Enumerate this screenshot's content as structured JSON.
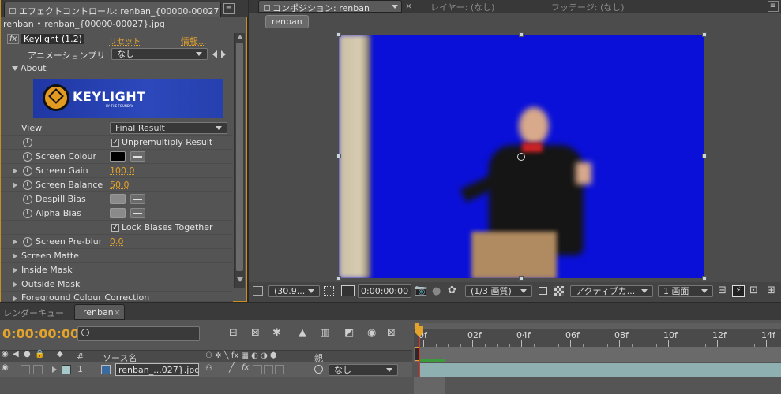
{
  "effects_panel": {
    "tab_title": "エフェクトコントロール: renban_{00000-00027",
    "breadcrumb": "renban • renban_{00000-00027}.jpg",
    "effect_name": "Keylight (1.2)",
    "fx_label": "fx",
    "reset_label": "リセット",
    "info_label": "情報...",
    "animation_preset_label": "アニメーションプリ",
    "animation_preset_value": "なし",
    "about_label": "About",
    "logo_text": "KEYLIGHT",
    "logo_sub": "BY THE FOUNDRY",
    "logo_color": "#2a44b8",
    "view_label": "View",
    "view_value": "Final Result",
    "unpremultiply_label": "Unpremultiply Result",
    "screen_colour_label": "Screen Colour",
    "screen_gain_label": "Screen Gain",
    "screen_gain_value": "100.0",
    "screen_balance_label": "Screen Balance",
    "screen_balance_value": "50.0",
    "despill_bias_label": "Despill Bias",
    "alpha_bias_label": "Alpha Bias",
    "lock_biases_label": "Lock Biases Together",
    "screen_preblur_label": "Screen Pre-blur",
    "screen_preblur_value": "0.0",
    "screen_matte_label": "Screen Matte",
    "inside_mask_label": "Inside Mask",
    "outside_mask_label": "Outside Mask",
    "fg_colour_label": "Foreground Colour Correction"
  },
  "comp_panel": {
    "tab_comp": "コンポジション: renban",
    "tab_layer": "レイヤー: (なし)",
    "tab_footage": "フッテージ: (なし)",
    "comp_button": "renban",
    "bluescreen_color": "#0a10d8",
    "zoom_value": "(30.9...",
    "timecode": "0:00:00:00",
    "resolution_value": "(1/3 画質)",
    "camera_value": "アクティブカ...",
    "views_value": "1 画面"
  },
  "timeline": {
    "tab_render": "レンダーキュー",
    "tab_comp": "renban",
    "current_time": "0:00:00:00",
    "col_num": "#",
    "col_source": "ソース名",
    "col_parent": "親",
    "layer_index": "1",
    "layer_name": "renban_...027}.jpg",
    "layer_parent": "なし",
    "ruler_labels": [
      "0f",
      "02f",
      "04f",
      "06f",
      "08f",
      "10f",
      "12f",
      "14f"
    ],
    "accent_color": "#e4a32b"
  }
}
